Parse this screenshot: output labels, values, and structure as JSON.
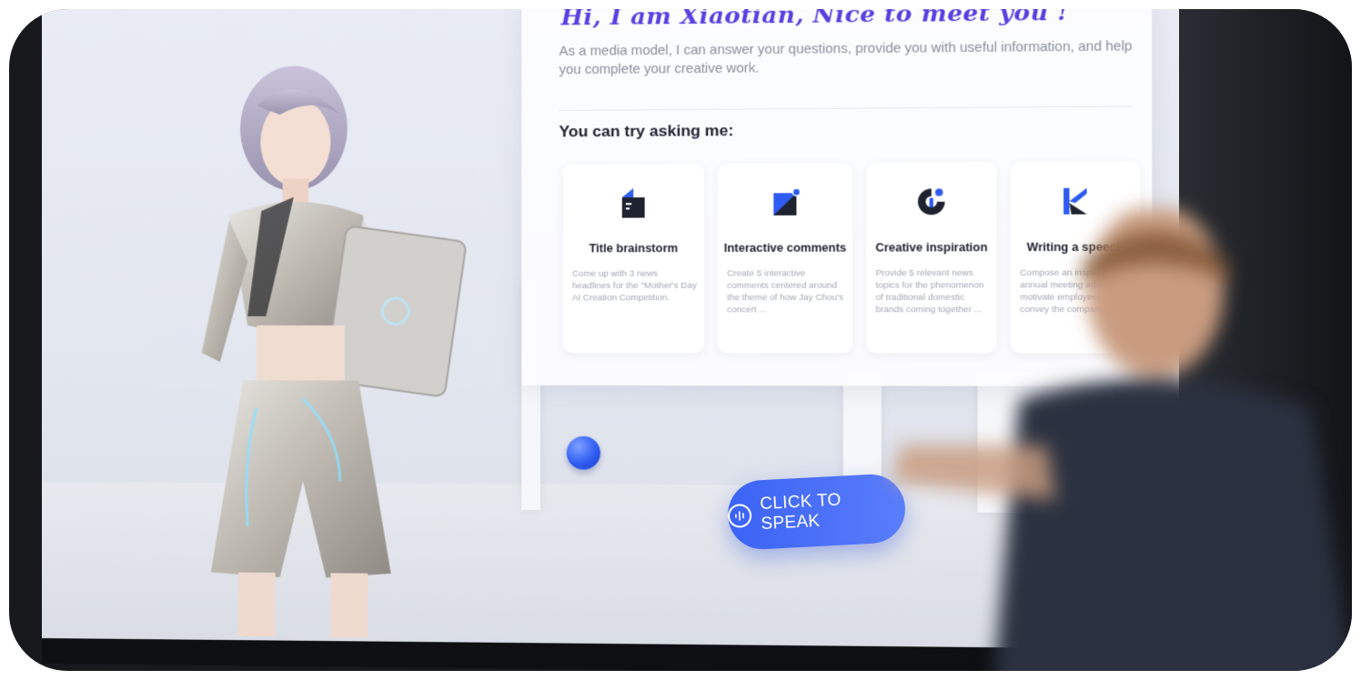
{
  "panel": {
    "greeting": "Hi, I am Xiaotian, Nice to meet you !",
    "intro": "As a media model, I can answer your questions, provide you with useful information, and help you complete your creative work.",
    "try_heading": "You can try asking me:",
    "cards": [
      {
        "icon": "document-icon",
        "title": "Title brainstorm",
        "description": "Come up with 3 news headlines for the \"Mother's Day AI Creation Competition."
      },
      {
        "icon": "chat-square-icon",
        "title": "Interactive comments",
        "description": "Create 5 interactive comments centered around the theme of how Jay Chou's concert ..."
      },
      {
        "icon": "lightbulb-icon",
        "title": "Creative inspiration",
        "description": "Provide 5 relevant news topics for the phenomenon of traditional domestic brands coming together ..."
      },
      {
        "icon": "pen-icon",
        "title": "Writing a speech",
        "description": "Compose an inspiring annual meeting address to motivate employees and convey the company's ..."
      }
    ]
  },
  "speak_button": {
    "label": "CLICK TO SPEAK",
    "icon": "microphone-icon"
  },
  "side_tools": [
    {
      "icon": "image-icon"
    },
    {
      "icon": "list-icon"
    }
  ],
  "colors": {
    "accent": "#3b63f5",
    "greeting": "#5a3fe0"
  }
}
